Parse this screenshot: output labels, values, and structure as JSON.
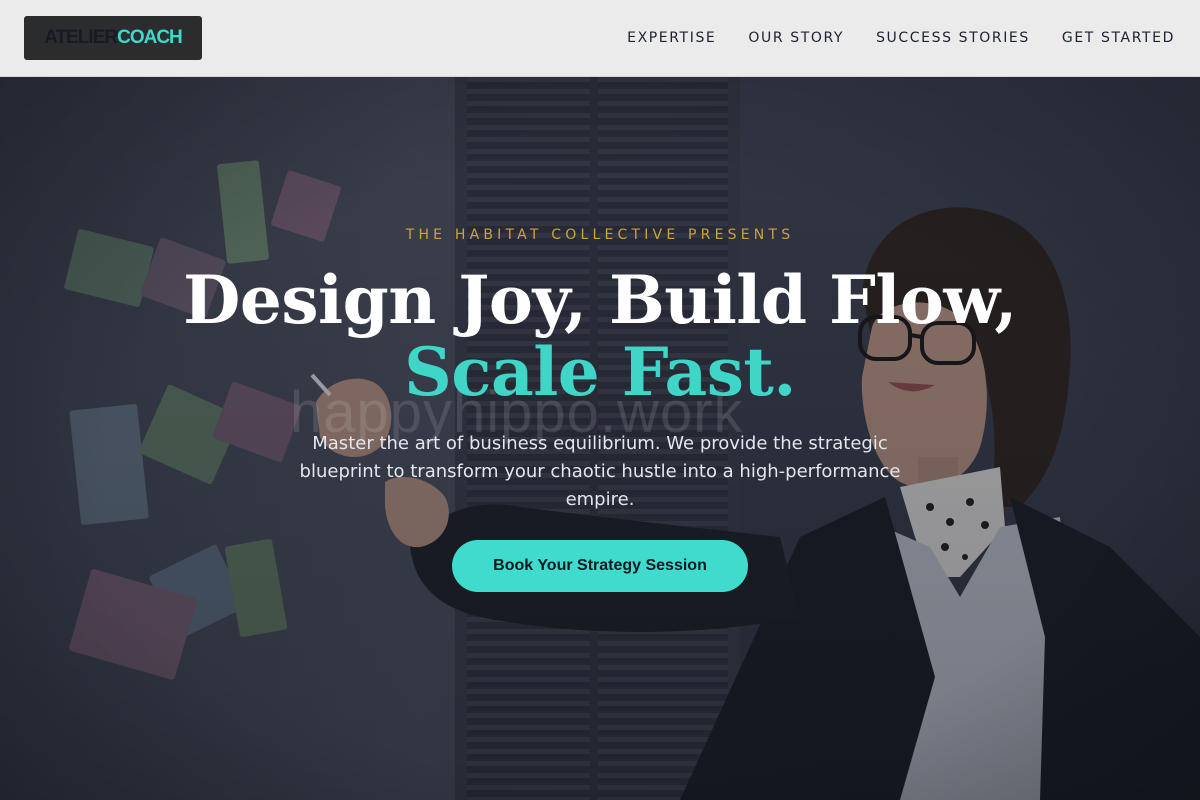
{
  "header": {
    "logo": {
      "word1": "ATELIER",
      "word2": "COACH"
    },
    "nav": [
      "EXPERTISE",
      "OUR STORY",
      "SUCCESS STORIES",
      "GET STARTED"
    ]
  },
  "hero": {
    "eyebrow": "THE HABITAT COLLECTIVE PRESENTS",
    "title_line1": "Design Joy, Build Flow,",
    "title_line2": "Scale Fast.",
    "subtitle": "Master the art of business equilibrium. We provide the strategic blueprint to transform your chaotic hustle into a high-performance empire.",
    "cta_label": "Book Your Strategy Session",
    "watermark": "happyhippo.work"
  },
  "colors": {
    "accent": "#3fd6c8",
    "eyebrow_gold": "#cda23c",
    "header_bg": "#ebebec",
    "logo_bg": "#2b2c2e",
    "nav_text": "#1c2230"
  }
}
